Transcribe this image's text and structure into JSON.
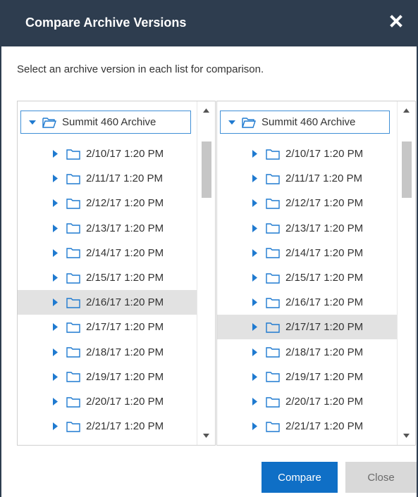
{
  "dialog": {
    "title": "Compare Archive Versions",
    "instructions": "Select an archive version in each list for comparison."
  },
  "left_panel": {
    "root_label": "Summit 460 Archive",
    "items": [
      "2/10/17 1:20 PM",
      "2/11/17 1:20 PM",
      "2/12/17 1:20 PM",
      "2/13/17 1:20 PM",
      "2/14/17 1:20 PM",
      "2/15/17 1:20 PM",
      "2/16/17 1:20 PM",
      "2/17/17 1:20 PM",
      "2/18/17 1:20 PM",
      "2/19/17 1:20 PM",
      "2/20/17 1:20 PM",
      "2/21/17 1:20 PM"
    ],
    "selected_item": "2/16/17 1:20 PM"
  },
  "right_panel": {
    "root_label": "Summit 460 Archive",
    "items": [
      "2/10/17 1:20 PM",
      "2/11/17 1:20 PM",
      "2/12/17 1:20 PM",
      "2/13/17 1:20 PM",
      "2/14/17 1:20 PM",
      "2/15/17 1:20 PM",
      "2/16/17 1:20 PM",
      "2/17/17 1:20 PM",
      "2/18/17 1:20 PM",
      "2/19/17 1:20 PM",
      "2/20/17 1:20 PM",
      "2/21/17 1:20 PM"
    ],
    "selected_item": "2/17/17 1:20 PM"
  },
  "buttons": {
    "compare_label": "Compare",
    "close_label": "Close"
  },
  "colors": {
    "titlebar": "#2e3d4f",
    "accent": "#0f6fc6",
    "icon_blue": "#1f7ad0",
    "selection": "#e2e2e2"
  },
  "icons": {
    "close": "close-x-icon",
    "expanded": "caret-down-icon",
    "collapsed": "caret-right-icon",
    "folder": "folder-outline-icon",
    "scroll_up": "scroll-up-arrow-icon",
    "scroll_down": "scroll-down-arrow-icon"
  }
}
